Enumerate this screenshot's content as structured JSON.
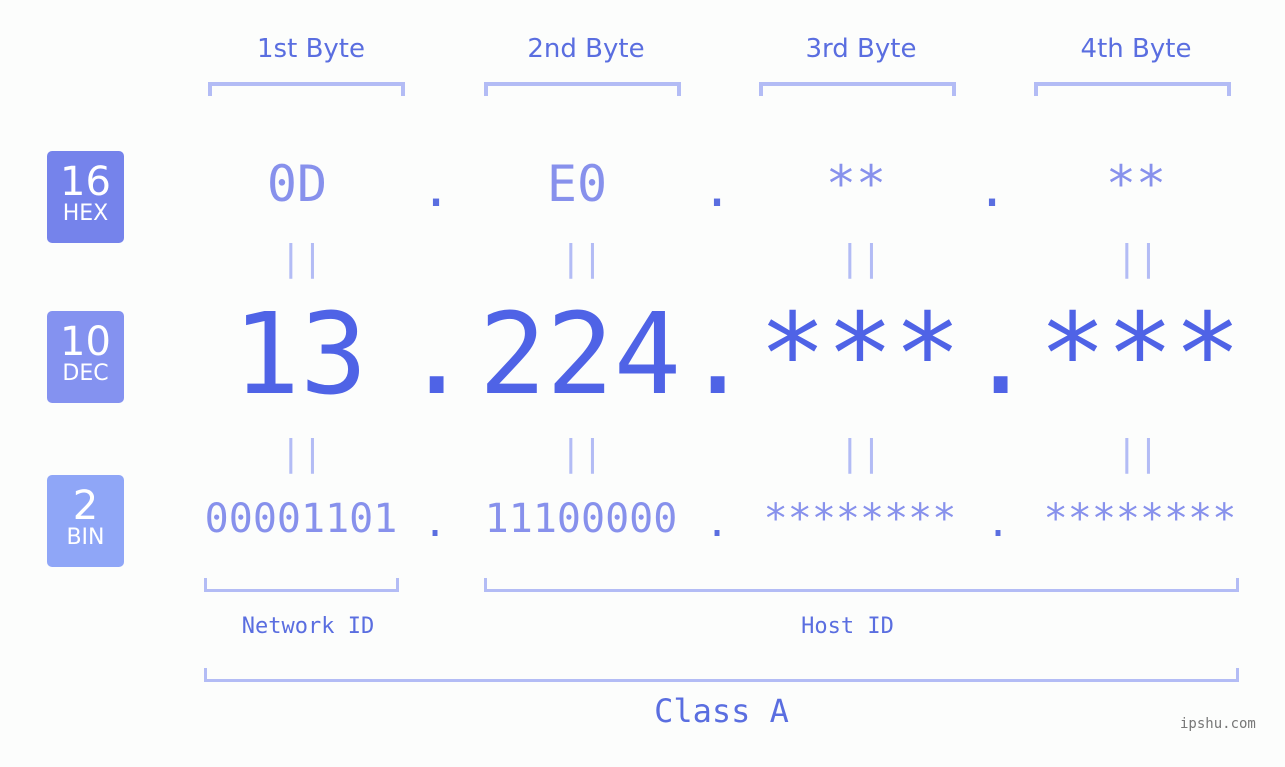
{
  "byte_headers": [
    "1st Byte",
    "2nd Byte",
    "3rd Byte",
    "4th Byte"
  ],
  "badges": [
    {
      "num": "16",
      "label": "HEX",
      "color": "#7583eb"
    },
    {
      "num": "10",
      "label": "DEC",
      "color": "#8492f0"
    },
    {
      "num": "2",
      "label": "BIN",
      "color": "#8fa6f7"
    }
  ],
  "hex": [
    "0D",
    "E0",
    "**",
    "**"
  ],
  "dec": [
    "13",
    "224",
    "***",
    "***"
  ],
  "bin": [
    "00001101",
    "11100000",
    "********",
    "********"
  ],
  "separator": ".",
  "equals": "||",
  "network_label": "Network ID",
  "host_label": "Host ID",
  "class_label": "Class A",
  "watermark": "ipshu.com",
  "colors": {
    "accent": "#4f63e6",
    "light": "#b3bcf5",
    "mid": "#8791ec"
  }
}
